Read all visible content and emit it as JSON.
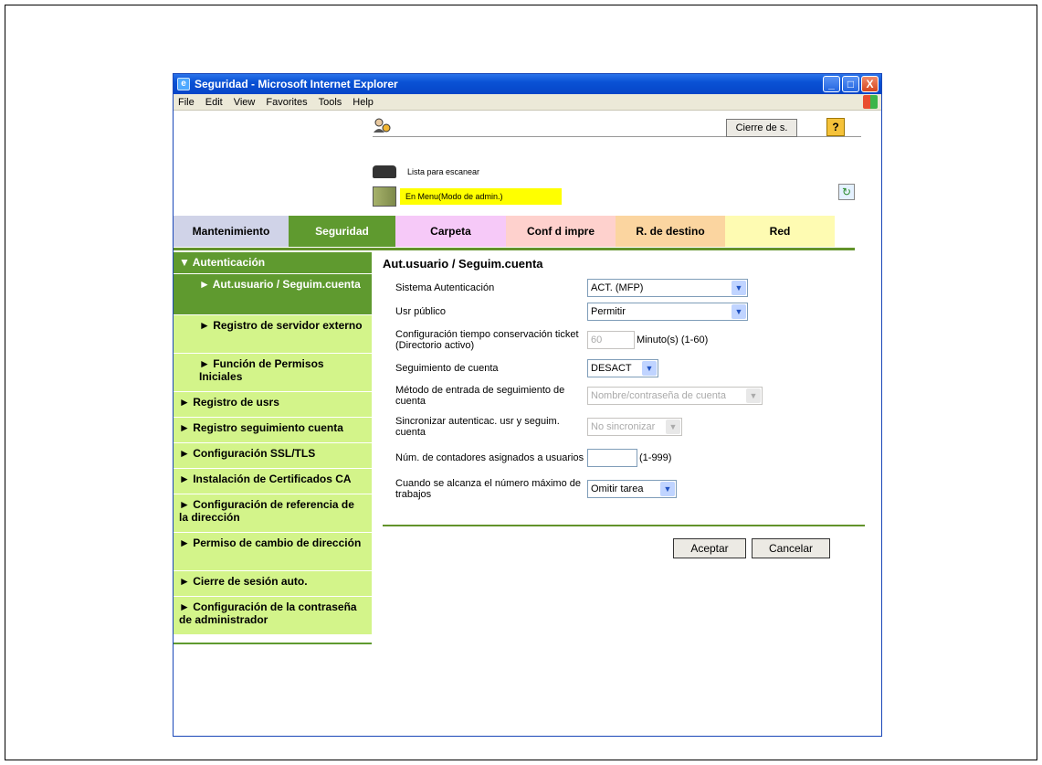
{
  "window": {
    "title": "Seguridad - Microsoft Internet Explorer",
    "minimize": "_",
    "maximize": "□",
    "close": "X"
  },
  "menu": [
    "File",
    "Edit",
    "View",
    "Favorites",
    "Tools",
    "Help"
  ],
  "header": {
    "logout_label": "Cierre de s.",
    "help_label": "?",
    "scan_status": "Lista para escanear",
    "admin_status": "En Menu(Modo de admin.)",
    "refresh_glyph": "↻"
  },
  "tabs": [
    {
      "label": "Mantenimiento",
      "bg": "#d0d3e8"
    },
    {
      "label": "Seguridad",
      "bg": "#5f9a2f",
      "color": "#ffffff"
    },
    {
      "label": "Carpeta",
      "bg": "#f6c9f8"
    },
    {
      "label": "Conf d impre",
      "bg": "#fed1cd"
    },
    {
      "label": "R. de destino",
      "bg": "#fbd5a0"
    },
    {
      "label": "Red",
      "bg": "#fefbb2"
    }
  ],
  "sidebar": {
    "head": "▼ Autenticación",
    "items": [
      {
        "label": "► Aut.usuario / Seguim.cuenta",
        "kind": "active"
      },
      {
        "label": "► Registro de servidor externo",
        "kind": "sub"
      },
      {
        "label": "► Función de Permisos Iniciales",
        "kind": "sub"
      },
      {
        "label": "► Registro de usrs",
        "kind": "top"
      },
      {
        "label": "► Registro seguimiento cuenta",
        "kind": "top"
      },
      {
        "label": "► Configuración SSL/TLS",
        "kind": "top"
      },
      {
        "label": "► Instalación de Certificados CA",
        "kind": "top"
      },
      {
        "label": "► Configuración de referencia de la dirección",
        "kind": "top"
      },
      {
        "label": "► Permiso de cambio de dirección",
        "kind": "top"
      },
      {
        "label": "► Cierre de sesión auto.",
        "kind": "top"
      },
      {
        "label": "► Configuración de la contraseña de administrador",
        "kind": "top"
      }
    ]
  },
  "main": {
    "title": "Aut.usuario / Seguim.cuenta",
    "fields": {
      "auth_system": {
        "label": "Sistema Autenticación",
        "value": "ACT. (MFP)"
      },
      "public_user": {
        "label": "Usr público",
        "value": "Permitir"
      },
      "ticket_time": {
        "label": "Configuración tiempo conservación ticket (Directorio activo)",
        "value": "60",
        "unit": "Minuto(s) (1-60)"
      },
      "account_track": {
        "label": "Seguimiento de cuenta",
        "value": "DESACT"
      },
      "account_method": {
        "label": "Método de entrada de seguimiento de cuenta",
        "value": "Nombre/contraseña de cuenta"
      },
      "sync": {
        "label": "Sincronizar autenticac. usr y seguim. cuenta",
        "value": "No sincronizar"
      },
      "counters": {
        "label": "Núm. de contadores asignados a usuarios",
        "value": "",
        "unit": "(1-999)"
      },
      "max_jobs": {
        "label": "Cuando se alcanza el número máximo de trabajos",
        "value": "Omitir tarea"
      }
    },
    "ok_label": "Aceptar",
    "cancel_label": "Cancelar"
  }
}
